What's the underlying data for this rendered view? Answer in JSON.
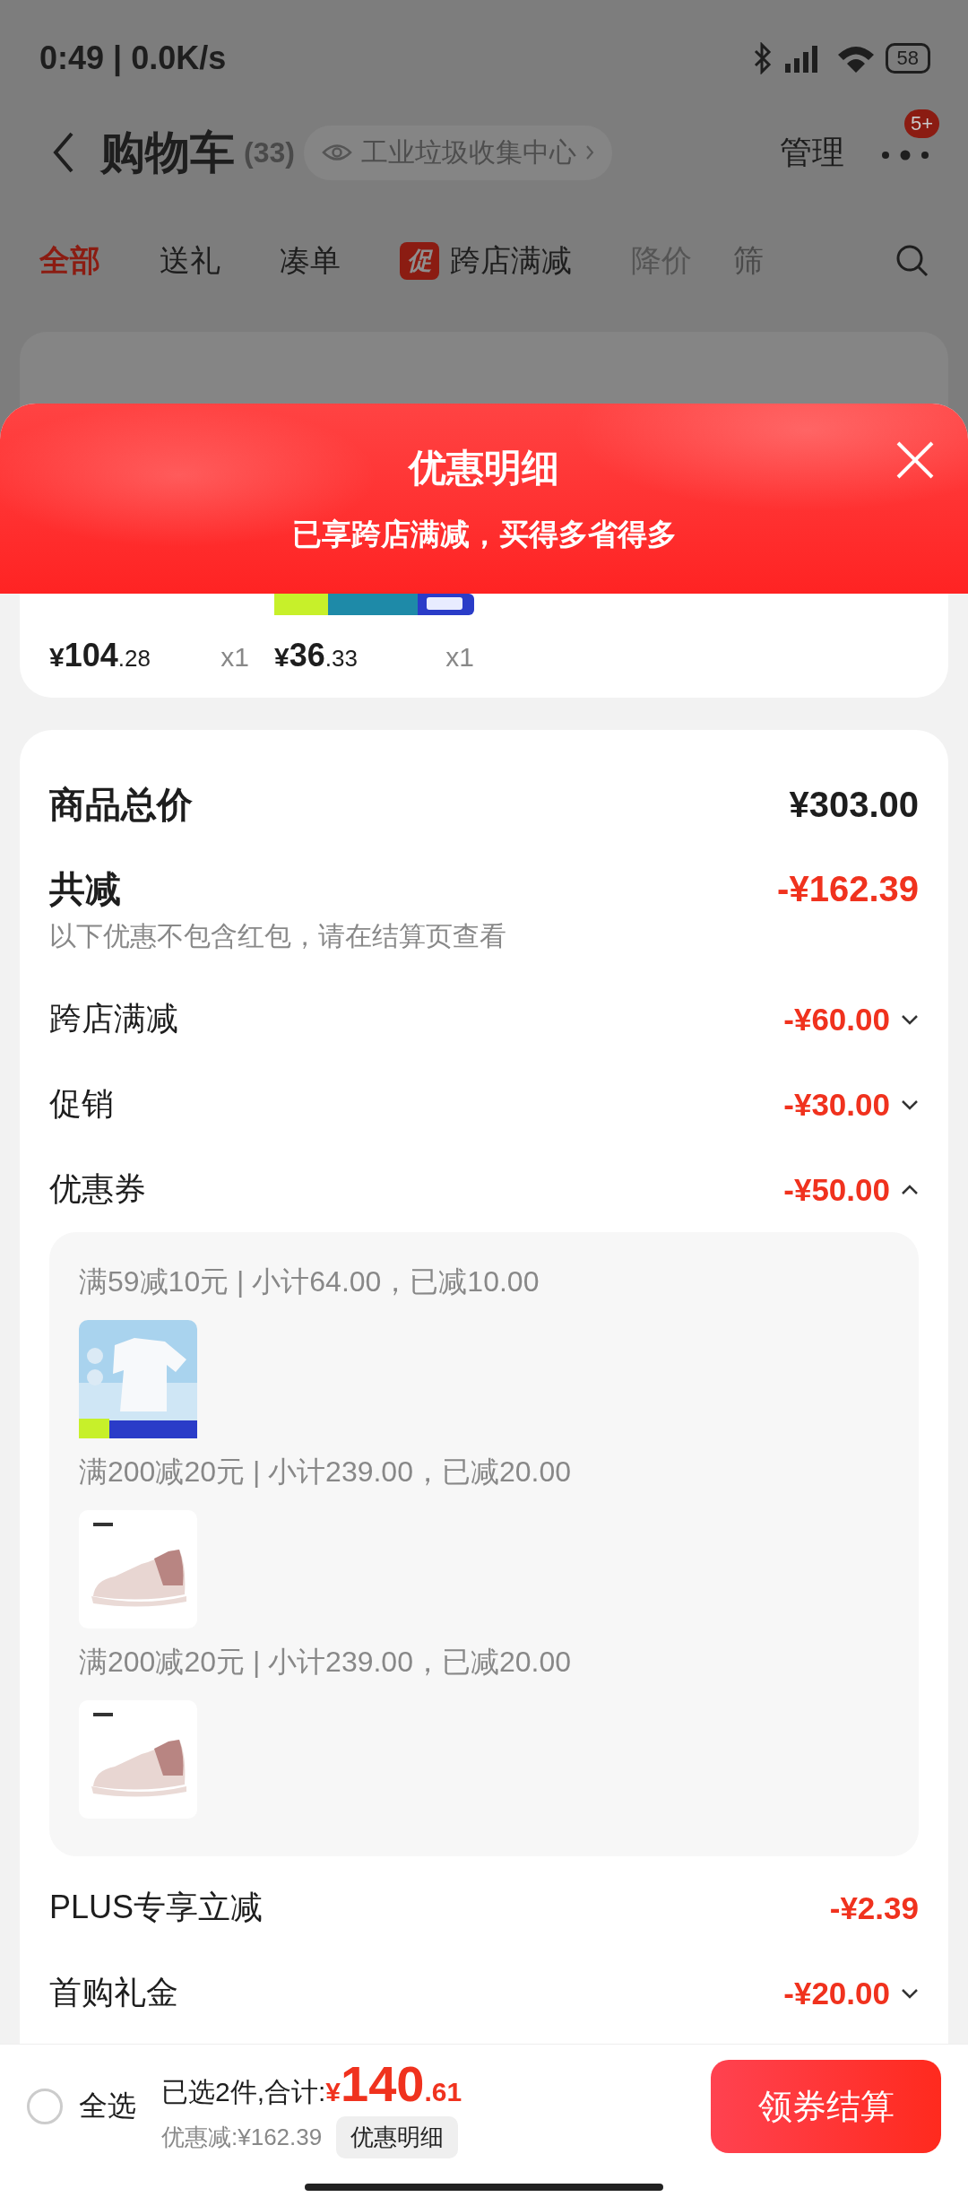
{
  "status_bar": {
    "time": "0:49 | 0.0K/s",
    "battery": "58"
  },
  "header": {
    "title": "购物车",
    "count": "(33)",
    "source_chip": "工业垃圾收集中心",
    "manage": "管理",
    "badge": "5+"
  },
  "tabs": [
    {
      "label": "全部",
      "kind": "plain",
      "selected": true
    },
    {
      "label": "送礼",
      "kind": "plain",
      "selected": false
    },
    {
      "label": "凑单",
      "kind": "plain",
      "selected": false
    },
    {
      "label": "跨店满减",
      "kind": "promo",
      "tag": "促",
      "selected": false
    },
    {
      "label": "降价",
      "kind": "muted",
      "selected": false
    },
    {
      "label": "筛",
      "kind": "faded",
      "selected": false
    }
  ],
  "sheet": {
    "title": "优惠明细",
    "subtitle": "已享跨店满减，买得多省得多",
    "items": [
      {
        "price": "¥104.28",
        "quantity": "x1"
      },
      {
        "price": "¥36.33",
        "quantity": "x1"
      }
    ],
    "summary": {
      "total_label": "商品总价",
      "total": "¥303.00",
      "saved_label": "共减",
      "saved": "-¥162.39",
      "note": "以下优惠不包含红包，请在结算页查看"
    },
    "discounts": [
      {
        "label": "跨店满减",
        "amount": "-¥60.00",
        "expanded": false
      },
      {
        "label": "促销",
        "amount": "-¥30.00",
        "expanded": false
      },
      {
        "label": "优惠券",
        "amount": "-¥50.00",
        "expanded": true,
        "coupons": [
          {
            "text": "满59减10元 | 小计64.00，已减10.00"
          },
          {
            "text": "满200减20元 | 小计239.00，已减20.00"
          },
          {
            "text": "满200减20元 | 小计239.00，已减20.00"
          }
        ]
      },
      {
        "label": "PLUS专享立减",
        "amount": "-¥2.39"
      },
      {
        "label": "首购礼金",
        "amount": "-¥20.00",
        "expanded": false
      }
    ]
  },
  "bottom_bar": {
    "select_all": {
      "label": "全选",
      "checked": false
    },
    "selected_text": "已选2件,合计:",
    "total": "¥140.61",
    "discount_text": "优惠减:¥162.39",
    "detail_button": "优惠明细",
    "checkout": "领券结算"
  }
}
